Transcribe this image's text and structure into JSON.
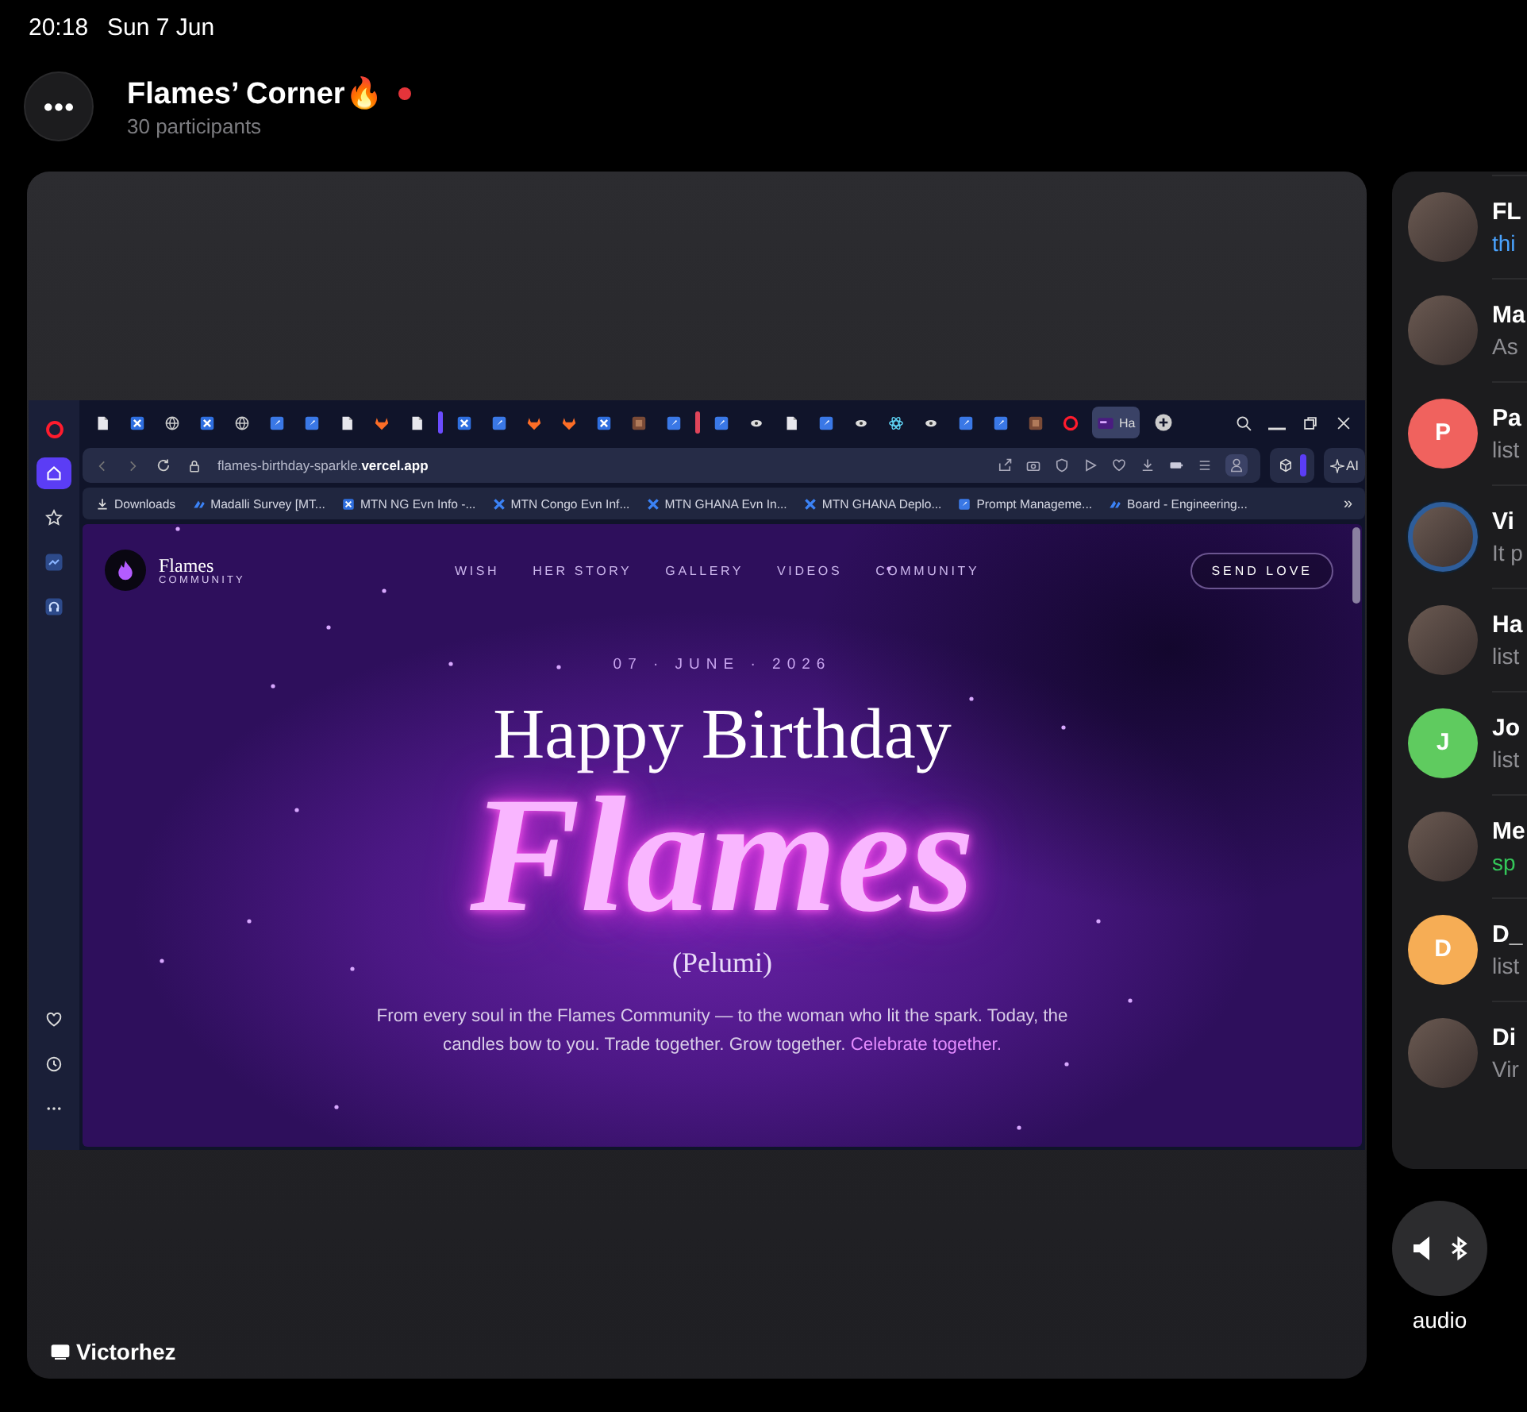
{
  "status_bar": {
    "time": "20:18",
    "date": "Sun 7 Jun"
  },
  "header": {
    "title": "Flames’ Corner🔥",
    "live": true,
    "subtitle": "30 participants"
  },
  "shared_screen": {
    "presenter": "Victorhez",
    "browser": {
      "sidebar": [
        {
          "kind": "opera",
          "selected": false
        },
        {
          "kind": "home",
          "selected": true
        },
        {
          "kind": "star",
          "selected": false
        },
        {
          "kind": "messenger",
          "selected": false
        },
        {
          "kind": "headphones",
          "selected": false
        },
        {
          "kind": "heart",
          "selected": false
        },
        {
          "kind": "clock",
          "selected": false
        },
        {
          "kind": "more",
          "selected": false
        }
      ],
      "tabs": [
        {
          "kind": "doc",
          "selected": false
        },
        {
          "kind": "jira",
          "selected": false
        },
        {
          "kind": "globe",
          "selected": false
        },
        {
          "kind": "jira",
          "selected": false
        },
        {
          "kind": "globe",
          "selected": false
        },
        {
          "kind": "rocket",
          "selected": false
        },
        {
          "kind": "rocket",
          "selected": false
        },
        {
          "kind": "doc",
          "selected": false
        },
        {
          "kind": "gitlab",
          "selected": false
        },
        {
          "kind": "doc",
          "selected": false
        },
        {
          "kind": "group",
          "color": "#6b4cff"
        },
        {
          "kind": "jira",
          "selected": false
        },
        {
          "kind": "rocket",
          "selected": false
        },
        {
          "kind": "gitlab",
          "selected": false
        },
        {
          "kind": "gitlab",
          "selected": false
        },
        {
          "kind": "jira",
          "selected": false
        },
        {
          "kind": "image",
          "selected": false
        },
        {
          "kind": "rocket",
          "selected": false
        },
        {
          "kind": "group",
          "color": "#e0455a"
        },
        {
          "kind": "rocket",
          "selected": false
        },
        {
          "kind": "eye",
          "selected": false
        },
        {
          "kind": "doc",
          "selected": false
        },
        {
          "kind": "rocket",
          "selected": false
        },
        {
          "kind": "eye",
          "selected": false
        },
        {
          "kind": "react",
          "selected": false
        },
        {
          "kind": "eye",
          "selected": false
        },
        {
          "kind": "rocket",
          "selected": false
        },
        {
          "kind": "rocket",
          "selected": false
        },
        {
          "kind": "image",
          "selected": false
        },
        {
          "kind": "opera",
          "selected": false
        },
        {
          "kind": "page",
          "selected": true,
          "label": "Ha"
        }
      ],
      "address": "flames-birthday-sparkle.**vercel.app**",
      "ai_button": "AI",
      "bookmarks": [
        {
          "kind": "download",
          "label": "Downloads"
        },
        {
          "kind": "board",
          "label": "Madalli Survey [MT..."
        },
        {
          "kind": "jira",
          "label": "MTN NG Evn Info -..."
        },
        {
          "kind": "cross",
          "label": "MTN Congo Evn Inf..."
        },
        {
          "kind": "cross",
          "label": "MTN GHANA Evn In..."
        },
        {
          "kind": "cross",
          "label": "MTN GHANA Deplo..."
        },
        {
          "kind": "rocket",
          "label": "Prompt Manageme..."
        },
        {
          "kind": "board",
          "label": "Board - Engineering..."
        }
      ],
      "bookmarks_more": "»",
      "site": {
        "logo_name": "Flames",
        "logo_tagline": "COMMUNITY",
        "nav": [
          "WISH",
          "HER STORY",
          "GALLERY",
          "VIDEOS",
          "COMMUNITY"
        ],
        "cta": "SEND LOVE",
        "date": "07 · JUNE · 2026",
        "heading": "Happy Birthday",
        "name": "Flames",
        "nickname": "(Pelumi)",
        "message": "From every soul in the Flames Community — to the woman who lit the spark. Today, the candles bow to you. Trade together. Grow together.",
        "message_highlight": "Celebrate together."
      }
    }
  },
  "participants": [
    {
      "name": "FL",
      "status": {
        "text": "thi",
        "color": "#4aa3ff"
      },
      "avatar": {
        "kind": "photo",
        "ring": false
      }
    },
    {
      "name": "Ma",
      "status": {
        "text": "As",
        "color": "#8e8e93"
      },
      "avatar": {
        "kind": "photo",
        "ring": false
      }
    },
    {
      "name": "Pa",
      "status": {
        "text": "list",
        "color": "#8e8e93"
      },
      "avatar": {
        "kind": "letter",
        "initial": "P",
        "color": "#f0625e",
        "ring": false
      }
    },
    {
      "name": "Vi",
      "status": {
        "text": "It p",
        "color": "#8e8e93"
      },
      "avatar": {
        "kind": "photo",
        "ring": true
      }
    },
    {
      "name": "Ha",
      "status": {
        "text": "list",
        "color": "#8e8e93"
      },
      "avatar": {
        "kind": "photo",
        "ring": false
      }
    },
    {
      "name": "Jo",
      "status": {
        "text": "list",
        "color": "#8e8e93"
      },
      "avatar": {
        "kind": "letter",
        "initial": "J",
        "color": "#5fcb5f",
        "ring": false
      }
    },
    {
      "name": "Me",
      "status": {
        "text": "sp",
        "color": "#34c759"
      },
      "avatar": {
        "kind": "photo",
        "ring": false
      }
    },
    {
      "name": "D_",
      "status": {
        "text": "list",
        "color": "#8e8e93"
      },
      "avatar": {
        "kind": "letter",
        "initial": "D",
        "color": "#f6ad55",
        "ring": false
      }
    },
    {
      "name": "Di",
      "status": {
        "text": "Vir",
        "color": "#8e8e93"
      },
      "avatar": {
        "kind": "photo",
        "ring": false
      }
    }
  ],
  "audio_button": {
    "label": "audio"
  }
}
